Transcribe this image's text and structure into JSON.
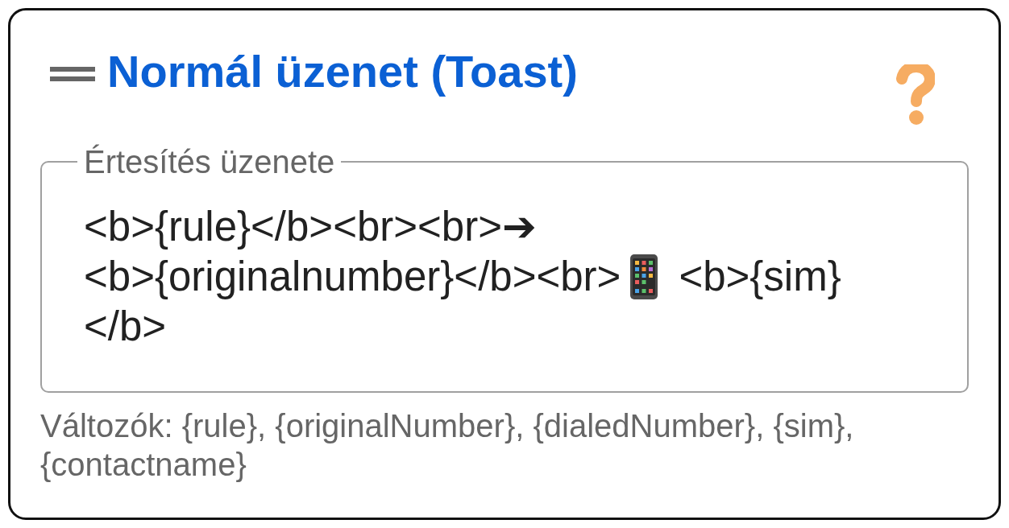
{
  "header": {
    "title": "Normál üzenet (Toast)"
  },
  "message_field": {
    "label": "Értesítés üzenete",
    "value_lines": [
      [
        {
          "kind": "text",
          "text": "<b>{rule}</b><br><br>➔"
        }
      ],
      [
        {
          "kind": "text",
          "text": "<b>{originalnumber}</b><br>"
        },
        {
          "kind": "phone_icon"
        },
        {
          "kind": "text",
          "text": "<b>{sim}"
        }
      ],
      [
        {
          "kind": "text",
          "text": "</b>"
        }
      ]
    ]
  },
  "helper_text": "Változók: {rule}, {originalNumber}, {dialedNumber}, {sim}, {contactname}"
}
